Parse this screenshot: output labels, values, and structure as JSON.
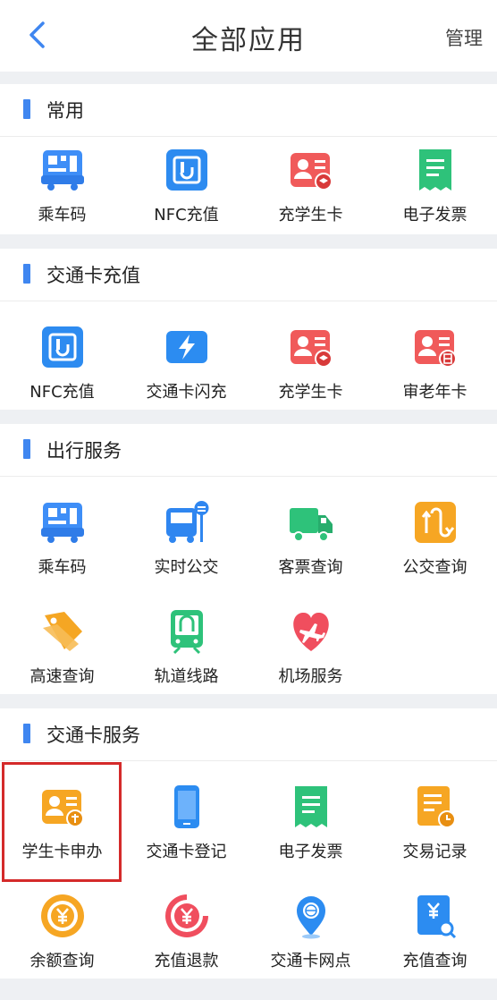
{
  "header": {
    "title": "全部应用",
    "manage_label": "管理"
  },
  "sections": [
    {
      "title": "常用",
      "items": [
        {
          "label": "乘车码",
          "icon": "bus-qr-icon"
        },
        {
          "label": "NFC充值",
          "icon": "nfc-card-icon"
        },
        {
          "label": "充学生卡",
          "icon": "student-card-icon"
        },
        {
          "label": "电子发票",
          "icon": "e-invoice-icon"
        }
      ]
    },
    {
      "title": "交通卡充值",
      "items": [
        {
          "label": "NFC充值",
          "icon": "nfc-card-icon"
        },
        {
          "label": "交通卡闪充",
          "icon": "flash-charge-icon"
        },
        {
          "label": "充学生卡",
          "icon": "student-card-icon"
        },
        {
          "label": "审老年卡",
          "icon": "senior-card-icon"
        }
      ]
    },
    {
      "title": "出行服务",
      "items": [
        {
          "label": "乘车码",
          "icon": "bus-qr-icon"
        },
        {
          "label": "实时公交",
          "icon": "realtime-bus-icon"
        },
        {
          "label": "客票查询",
          "icon": "truck-icon"
        },
        {
          "label": "公交查询",
          "icon": "route-icon"
        },
        {
          "label": "高速查询",
          "icon": "highway-tag-icon"
        },
        {
          "label": "轨道线路",
          "icon": "metro-icon"
        },
        {
          "label": "机场服务",
          "icon": "airplane-heart-icon"
        }
      ]
    },
    {
      "title": "交通卡服务",
      "items": [
        {
          "label": "学生卡申办",
          "icon": "student-apply-icon"
        },
        {
          "label": "交通卡登记",
          "icon": "phone-icon"
        },
        {
          "label": "电子发票",
          "icon": "e-invoice-icon"
        },
        {
          "label": "交易记录",
          "icon": "transaction-icon"
        },
        {
          "label": "余额查询",
          "icon": "balance-coin-icon"
        },
        {
          "label": "充值退款",
          "icon": "refund-icon"
        },
        {
          "label": "交通卡网点",
          "icon": "location-pin-icon"
        },
        {
          "label": "充值查询",
          "icon": "recharge-search-icon"
        }
      ]
    }
  ],
  "colors": {
    "accent": "#3f86f0",
    "highlight": "#d42a2a"
  }
}
